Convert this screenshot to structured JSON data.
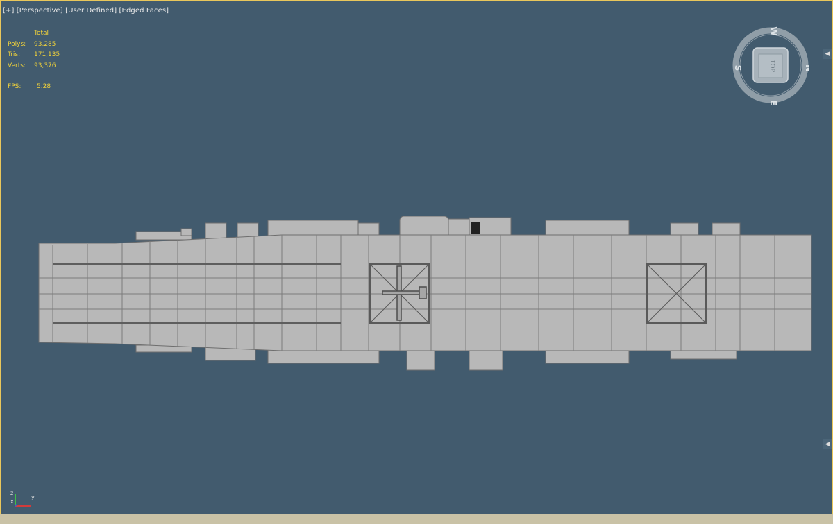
{
  "viewport": {
    "label_plus": "[+]",
    "label_view": "[Perspective]",
    "label_shading": "[User Defined]",
    "label_edges": "[Edged Faces]"
  },
  "stats": {
    "header": "Total",
    "polys_label": "Polys:",
    "polys_value": "93,285",
    "tris_label": "Tris:",
    "tris_value": "171,135",
    "verts_label": "Verts:",
    "verts_value": "93,376",
    "fps_label": "FPS:",
    "fps_value": "5.28"
  },
  "viewcube": {
    "face_label": "TOP",
    "north": "N",
    "south": "S",
    "east": "E",
    "west": "W"
  },
  "axis": {
    "x": "x",
    "y": "y",
    "z": "z"
  },
  "colors": {
    "viewport_bg": "#425b6e",
    "stats_text": "#f2d33a",
    "active_border": "#e9c75b",
    "model_fill": "#b9b9b9",
    "model_edges": "#707070"
  }
}
